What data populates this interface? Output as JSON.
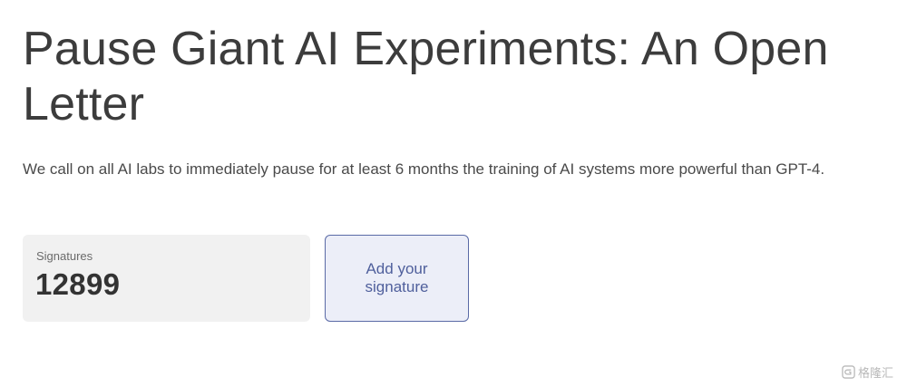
{
  "letter": {
    "title": "Pause Giant AI Experiments: An Open Letter",
    "intro": "We call on all AI labs to immediately pause for at least 6 months the training of AI systems more powerful than GPT-4."
  },
  "signatures": {
    "label": "Signatures",
    "count": "12899"
  },
  "actions": {
    "add_signature_label": "Add your signature"
  },
  "watermark": {
    "text": "格隆汇",
    "icon": "g-logo-icon"
  },
  "colors": {
    "title_text": "#3c3c3c",
    "card_background": "#f1f1f1",
    "button_background": "#eceef8",
    "button_border": "#5a6aa6",
    "button_text": "#4f5f9c"
  }
}
